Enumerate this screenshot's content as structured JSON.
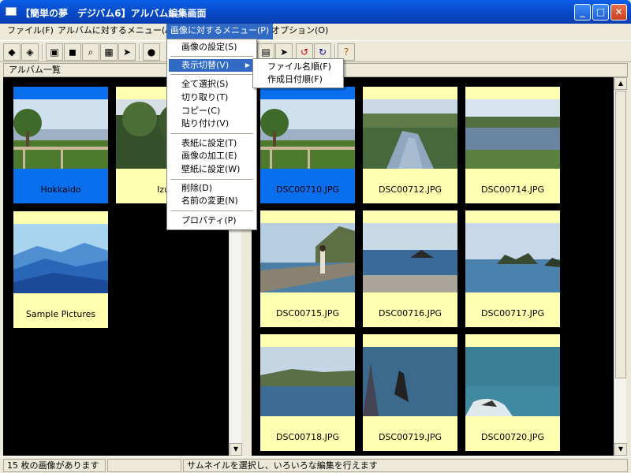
{
  "window": {
    "title": "【簡単の夢　デジバム6】アルバム編集画面",
    "minimize": "_",
    "maximize": "□",
    "close": "✕"
  },
  "menubar": {
    "items": [
      {
        "label": "ファイル(F)"
      },
      {
        "label": "アルバムに対するメニュー(A)"
      },
      {
        "label": "画像に対するメニュー(P)"
      },
      {
        "label": "オプション(O)"
      }
    ]
  },
  "panes": {
    "left_header": "アルバム一覧"
  },
  "albums": [
    {
      "name": "Hokkaido",
      "selected": true,
      "image": "landscape"
    },
    {
      "name": "Izu",
      "selected": false,
      "image": "forest"
    },
    {
      "name": "Sample Pictures",
      "selected": false,
      "image": "mountains"
    }
  ],
  "photos": [
    {
      "name": "DSC00710.JPG",
      "selected": true,
      "image": "landscape"
    },
    {
      "name": "DSC00712.JPG",
      "selected": false,
      "image": "marsh"
    },
    {
      "name": "DSC00714.JPG",
      "selected": false,
      "image": "pond"
    },
    {
      "name": "DSC00715.JPG",
      "selected": false,
      "image": "pier"
    },
    {
      "name": "DSC00716.JPG",
      "selected": false,
      "image": "rocks"
    },
    {
      "name": "DSC00717.JPG",
      "selected": false,
      "image": "island"
    },
    {
      "name": "DSC00718.JPG",
      "selected": false,
      "image": "coast"
    },
    {
      "name": "DSC00719.JPG",
      "selected": false,
      "image": "sea"
    },
    {
      "name": "DSC00720.JPG",
      "selected": false,
      "image": "reef"
    }
  ],
  "image_menu": {
    "items": [
      "画像の設定(S)",
      "表示切替(V)",
      "全て選択(S)",
      "切り取り(T)",
      "コピー(C)",
      "貼り付け(V)",
      "表紙に設定(T)",
      "画像の加工(E)",
      "壁紙に設定(W)",
      "削除(D)",
      "名前の変更(N)",
      "プロパティ(P)"
    ],
    "submenu_arrow": "▶"
  },
  "view_submenu": {
    "items": [
      "ファイル名順(F)",
      "作成日付順(F)"
    ]
  },
  "statusbar": {
    "count_text": "15 枚の画像があります",
    "hint_text": "サムネイルを選択し、いろいろな編集を行えます"
  },
  "scrollbar": {
    "up": "▲",
    "down": "▼"
  },
  "colors": {
    "selection": "#0A6FEF",
    "tile_bg": "#FFFFB0",
    "menu_highlight": "#316AC5",
    "title_bar": "#0A5FE8"
  }
}
